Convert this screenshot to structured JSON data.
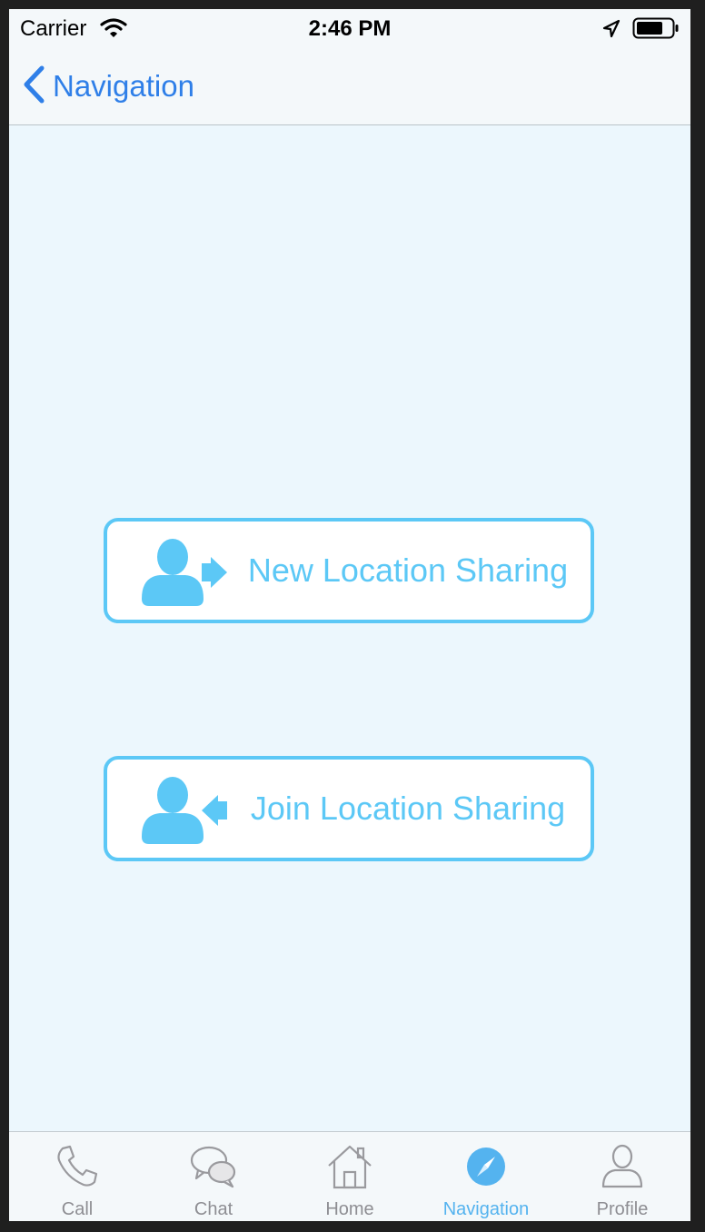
{
  "status_bar": {
    "carrier": "Carrier",
    "time": "2:46 PM",
    "icons": [
      "wifi-icon",
      "location-arrow-icon",
      "battery-icon"
    ]
  },
  "nav_bar": {
    "back_label": "Navigation",
    "back_icon": "chevron-left-icon",
    "accent_color": "#2f7fe8"
  },
  "main": {
    "buttons": [
      {
        "label": "New Location Sharing",
        "icon": "user-arrow-out-icon"
      },
      {
        "label": "Join Location Sharing",
        "icon": "user-arrow-in-icon"
      }
    ],
    "button_color": "#5cc8f6"
  },
  "tab_bar": {
    "tabs": [
      {
        "label": "Call",
        "icon": "phone-icon",
        "active": false
      },
      {
        "label": "Chat",
        "icon": "chat-bubbles-icon",
        "active": false
      },
      {
        "label": "Home",
        "icon": "home-icon",
        "active": false
      },
      {
        "label": "Navigation",
        "icon": "compass-icon",
        "active": true
      },
      {
        "label": "Profile",
        "icon": "person-icon",
        "active": false
      }
    ],
    "active_color": "#54b3ef",
    "inactive_color": "#8e8e93"
  }
}
